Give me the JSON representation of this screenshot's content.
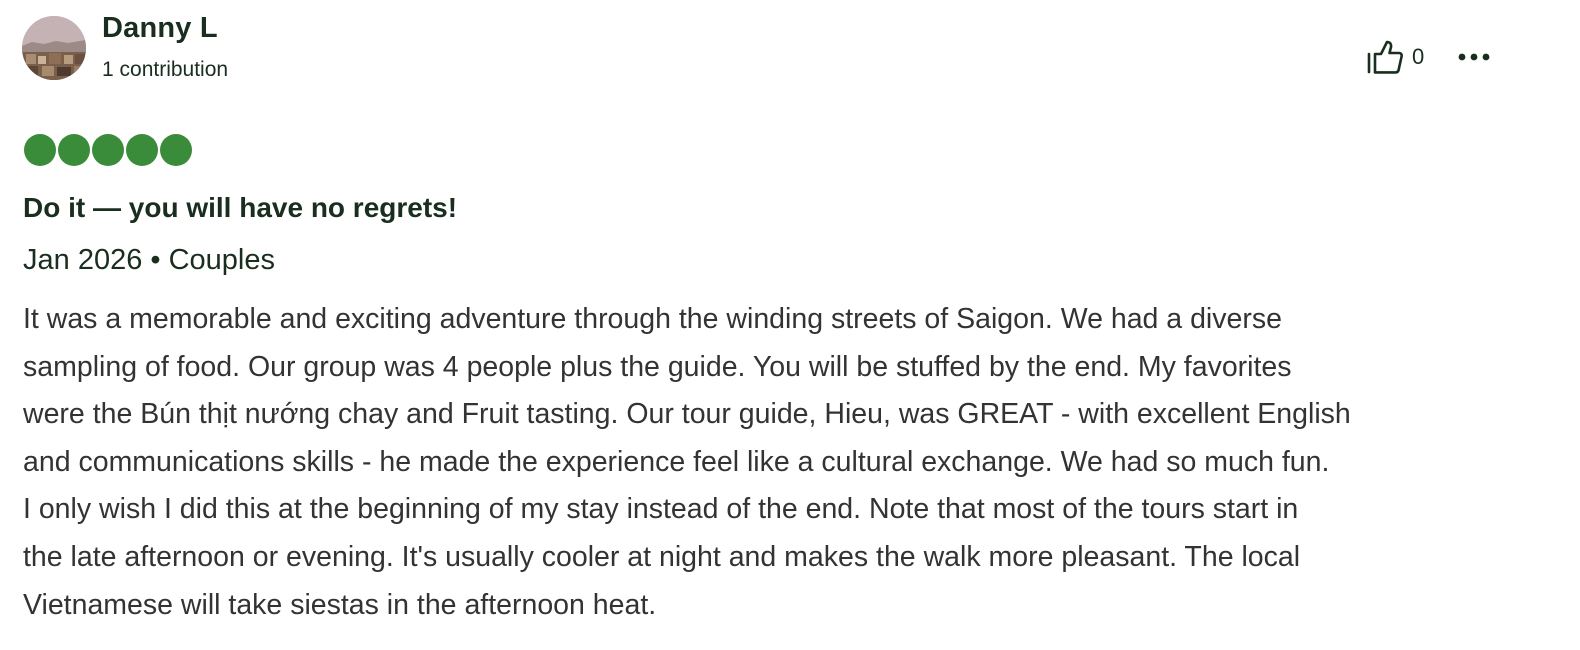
{
  "user": {
    "name": "Danny L",
    "contributions": "1 contribution",
    "avatar": "avatar-photo"
  },
  "actions": {
    "helpful_icon": "thumbs-up-icon",
    "helpful_count": "0",
    "more_icon": "more-options-icon"
  },
  "rating": {
    "value": 5,
    "max": 5,
    "color": "#3b8c3a"
  },
  "review": {
    "title": "Do it — you will have no regrets!",
    "meta": "Jan 2026 • Couples",
    "body_lines": [
      "It was a memorable and exciting adventure through the winding streets of Saigon. We had a diverse",
      "sampling of food. Our group was 4 people plus the guide. You will be stuffed by the end. My favorites",
      "were the Bún thịt nướng chay and Fruit tasting. Our tour guide, Hieu, was GREAT - with excellent English",
      "and communications skills - he made the experience feel like a cultural exchange. We had so much fun.",
      "I only wish I did this at the beginning of my stay instead of the end. Note that most of the tours start in",
      "the late afternoon or evening. It's usually cooler at night and makes the walk more pleasant. The local",
      "Vietnamese will take siestas in the afternoon heat."
    ]
  }
}
